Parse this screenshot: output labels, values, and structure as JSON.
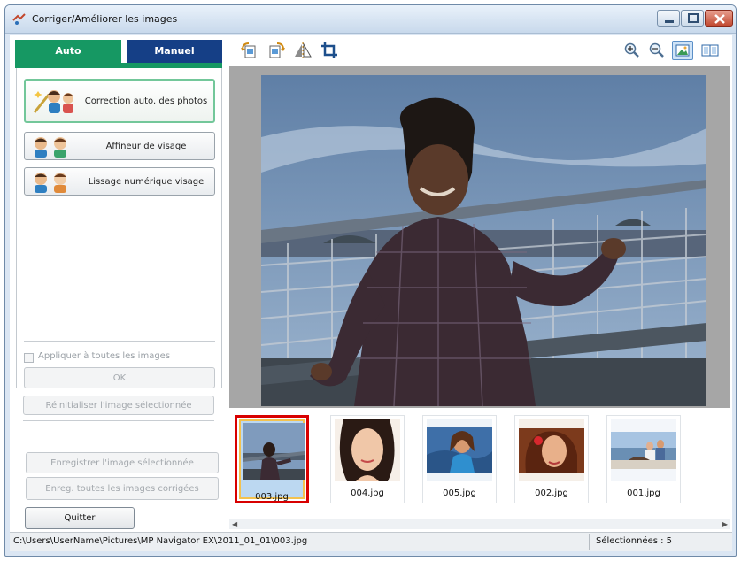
{
  "window": {
    "title": "Corriger/Améliorer les images"
  },
  "tabs": {
    "auto": "Auto",
    "manual": "Manuel"
  },
  "auto_panel": {
    "buttons": [
      {
        "label": "Correction auto. des photos",
        "icon": "auto-photo-correction-icon",
        "selected": true
      },
      {
        "label": "Affineur de visage",
        "icon": "face-sharpener-icon",
        "selected": false
      },
      {
        "label": "Lissage numérique visage",
        "icon": "digital-face-smoothing-icon",
        "selected": false
      }
    ],
    "apply_all_label": "Appliquer à toutes les images",
    "ok_label": "OK",
    "reset_label": "Réinitialiser l'image sélectionnée"
  },
  "left_bottom": {
    "save_selected_label": "Enregistrer l'image sélectionnée",
    "save_all_label": "Enreg. toutes les images corrigées",
    "quit_label": "Quitter"
  },
  "toolbar": {
    "left_icons": [
      "rotate-left-icon",
      "rotate-right-icon",
      "flip-icon",
      "crop-icon"
    ],
    "right_icons": [
      "zoom-in-icon",
      "zoom-out-icon",
      "whole-image-view-icon",
      "compare-view-icon"
    ],
    "active_icon": "whole-image-view-icon"
  },
  "thumbnails": [
    {
      "name": "003.jpg",
      "selected": true
    },
    {
      "name": "004.jpg",
      "selected": false
    },
    {
      "name": "005.jpg",
      "selected": false
    },
    {
      "name": "002.jpg",
      "selected": false
    },
    {
      "name": "001.jpg",
      "selected": false
    }
  ],
  "status": {
    "path": "C:\\Users\\UserName\\Pictures\\MP Navigator EX\\2011_01_01\\003.jpg",
    "selected": "Sélectionnées : 5"
  },
  "colors": {
    "auto_tab": "#169863",
    "manual_tab": "#153f86",
    "thumb_selection": "#d80000"
  }
}
